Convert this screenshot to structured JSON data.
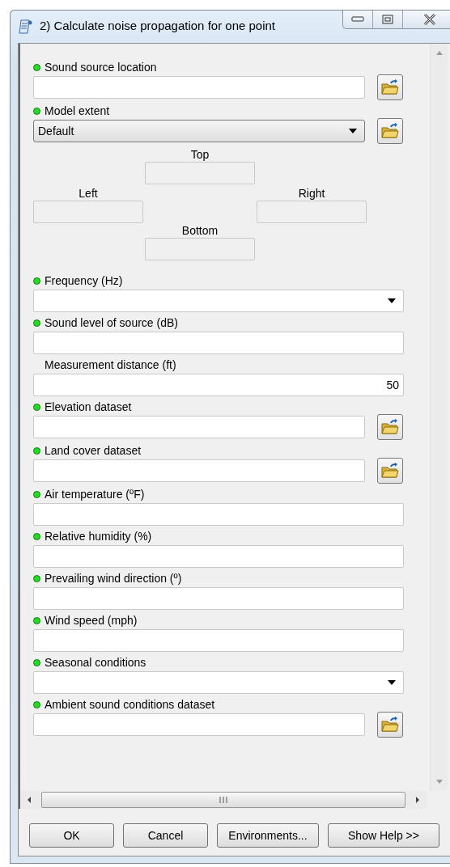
{
  "window": {
    "title": "2) Calculate noise propagation for one point"
  },
  "parameters": [
    {
      "kind": "file",
      "label": "Sound source location",
      "required": true
    },
    {
      "kind": "choice-browse",
      "label": "Model extent",
      "required": true,
      "value": "Default",
      "extent": {
        "top": "Top",
        "left": "Left",
        "right": "Right",
        "bottom": "Bottom"
      }
    },
    {
      "kind": "choice",
      "label": "Frequency (Hz)",
      "required": true
    },
    {
      "kind": "text",
      "label": "Sound level of source (dB)",
      "required": true
    },
    {
      "kind": "text",
      "label": "Measurement distance (ft)",
      "required": false,
      "value": "50"
    },
    {
      "kind": "file",
      "label": "Elevation dataset",
      "required": true
    },
    {
      "kind": "file",
      "label": "Land cover dataset",
      "required": true
    },
    {
      "kind": "text",
      "label": "Air temperature (ºF)",
      "required": true
    },
    {
      "kind": "text",
      "label": "Relative humidity (%)",
      "required": true
    },
    {
      "kind": "text",
      "label": "Prevailing wind direction (º)",
      "required": true
    },
    {
      "kind": "text",
      "label": "Wind speed (mph)",
      "required": true
    },
    {
      "kind": "choice",
      "label": "Seasonal conditions",
      "required": true
    },
    {
      "kind": "file",
      "label": "Ambient sound conditions dataset",
      "required": true
    }
  ],
  "buttons": [
    "OK",
    "Cancel",
    "Environments...",
    "Show Help >>"
  ]
}
